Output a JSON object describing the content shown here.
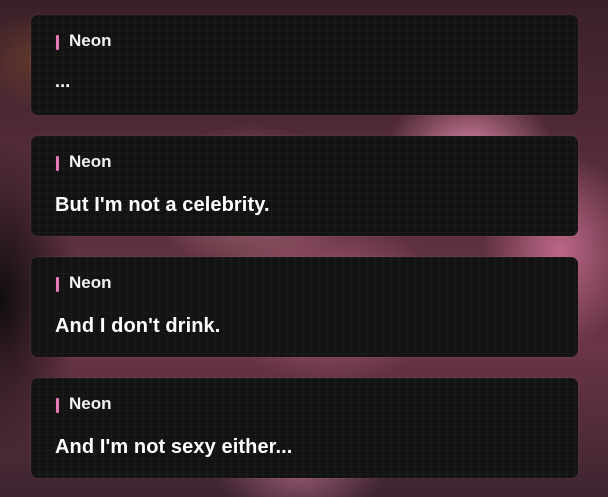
{
  "dialogue": [
    {
      "speaker": "Neon",
      "text": "..."
    },
    {
      "speaker": "Neon",
      "text": "But I'm not a celebrity."
    },
    {
      "speaker": "Neon",
      "text": "And I don't drink."
    },
    {
      "speaker": "Neon",
      "text": "And I'm not sexy either..."
    }
  ],
  "colors": {
    "accent": "#e879b8",
    "panel": "#131313",
    "text": "#ffffff"
  }
}
